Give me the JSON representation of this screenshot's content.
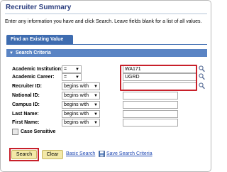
{
  "page": {
    "title": "Recruiter Summary",
    "instructions": "Enter any information you have and click Search. Leave fields blank for a list of all values."
  },
  "tab": {
    "label": "Find an Existing Value"
  },
  "section": {
    "label": "Search Criteria",
    "icon": "triangle-down-icon"
  },
  "fields": [
    {
      "label": "Academic Institution:",
      "operator": "=",
      "value": "WA171",
      "has_lookup": true
    },
    {
      "label": "Academic Career:",
      "operator": "=",
      "value": "UGRD",
      "has_lookup": true
    },
    {
      "label": "Recruiter ID:",
      "operator": "begins with",
      "value": "",
      "has_lookup": true
    },
    {
      "label": "National ID:",
      "operator": "begins with",
      "value": "",
      "has_lookup": false
    },
    {
      "label": "Campus ID:",
      "operator": "begins with",
      "value": "",
      "has_lookup": false
    },
    {
      "label": "Last Name:",
      "operator": "begins with",
      "value": "",
      "has_lookup": false
    },
    {
      "label": "First Name:",
      "operator": "begins with",
      "value": "",
      "has_lookup": false
    }
  ],
  "case_sensitive": {
    "label": "Case Sensitive",
    "checked": false
  },
  "buttons": {
    "search": "Search",
    "clear": "Clear",
    "basic_search": "Basic Search",
    "save_search": "Save Search Criteria"
  },
  "colors": {
    "title": "#2a3d7e",
    "tab": "#3e6cb0",
    "section": "#5a84c4",
    "button": "#f3e9a8",
    "highlight": "#c8202a",
    "link": "#2049b4"
  }
}
